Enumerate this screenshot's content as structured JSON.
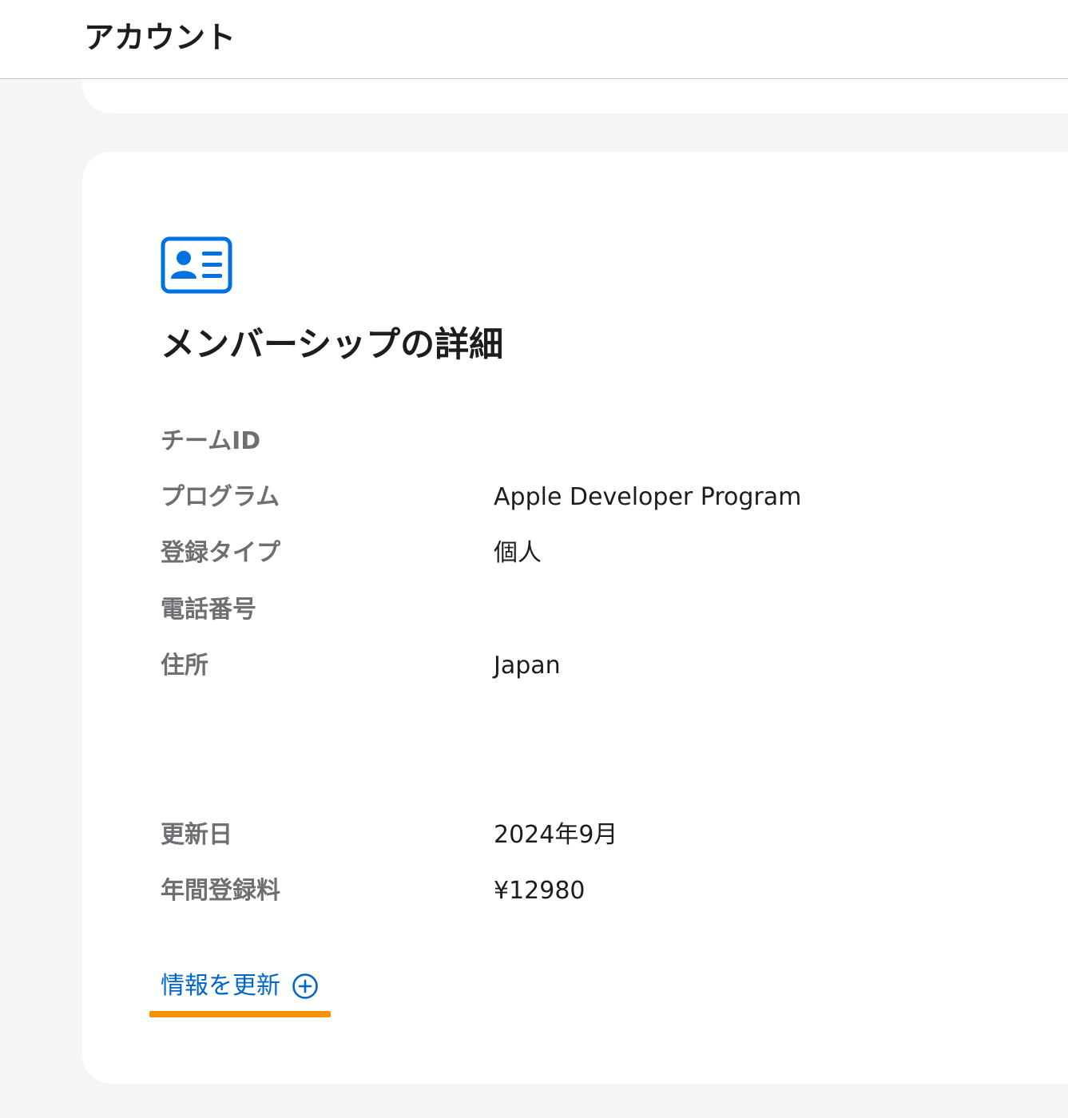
{
  "header": {
    "title": "アカウント"
  },
  "membership": {
    "icon": "id-card-icon",
    "title": "メンバーシップの詳細",
    "fields": {
      "team_id": {
        "label": "チームID",
        "value": ""
      },
      "program": {
        "label": "プログラム",
        "value": "Apple Developer Program"
      },
      "enrollment_type": {
        "label": "登録タイプ",
        "value": "個人"
      },
      "phone": {
        "label": "電話番号",
        "value": ""
      },
      "address": {
        "label": "住所",
        "value": "Japan"
      },
      "renewal_date": {
        "label": "更新日",
        "value": "2024年9月"
      },
      "annual_fee": {
        "label": "年間登録料",
        "value": "¥12980"
      }
    },
    "update_link": {
      "label": "情報を更新",
      "icon": "plus-circle-icon"
    }
  },
  "colors": {
    "accent": "#0066cc",
    "highlight": "#f39200",
    "background": "#f5f5f7",
    "card": "#ffffff"
  }
}
